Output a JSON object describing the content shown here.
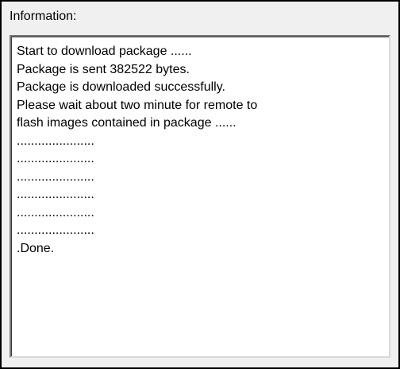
{
  "panel": {
    "title": "Information:"
  },
  "log": {
    "lines": [
      "Start to download package ......",
      "Package is sent 382522 bytes.",
      "Package is downloaded successfully.",
      "Please wait about two minute for remote to",
      "flash images contained in package ......",
      "......................",
      "......................",
      "......................",
      "......................",
      "......................",
      "......................",
      ".Done."
    ]
  }
}
